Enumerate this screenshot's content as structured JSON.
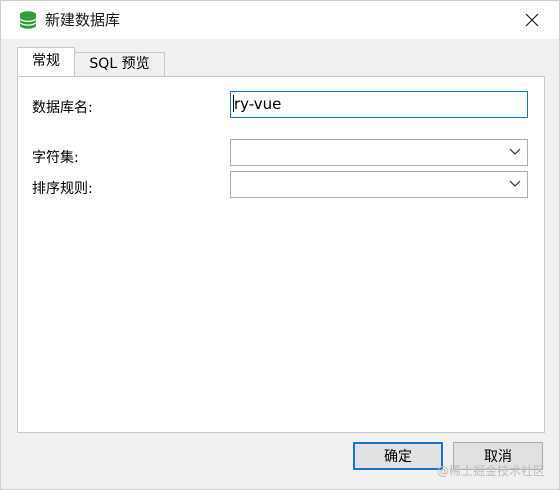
{
  "window": {
    "title": "新建数据库",
    "icon": "database-icon"
  },
  "tabs": [
    {
      "label": "常规",
      "active": true
    },
    {
      "label": "SQL 预览",
      "active": false
    }
  ],
  "form": {
    "db_name_label": "数据库名:",
    "db_name_value": "ry-vue",
    "charset_label": "字符集:",
    "charset_value": "",
    "collation_label": "排序规则:",
    "collation_value": ""
  },
  "buttons": {
    "ok": "确定",
    "cancel": "取消"
  },
  "watermark": "@稀土掘金技术社区",
  "colors": {
    "accent": "#1a74c9",
    "db_icon": "#2e9c3a"
  }
}
